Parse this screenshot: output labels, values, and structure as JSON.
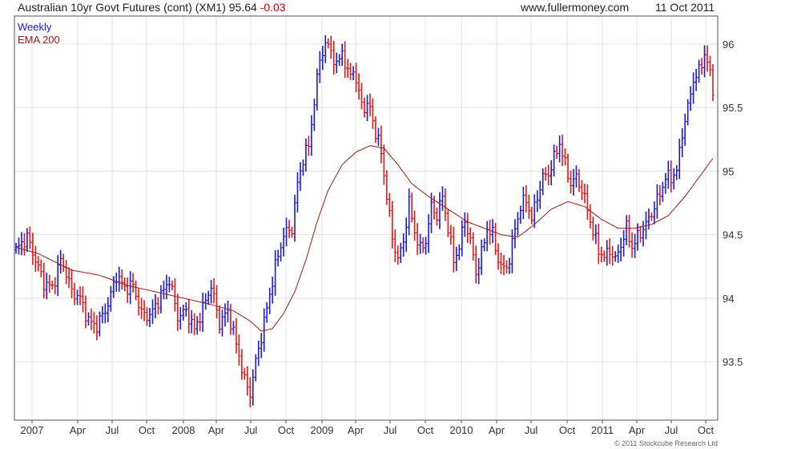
{
  "header": {
    "title_prefix": "Australian 10yr Govt Futures (cont) (XM1) 95.64",
    "change": "-0.03",
    "site": "www.fullermoney.com",
    "date": "11 Oct 2011"
  },
  "footer": {
    "credit": "© 2011 Stockcube Research Ltd"
  },
  "colors": {
    "up": "#1a1ad8",
    "down": "#e01818",
    "ema": "#a01818",
    "grid": "#e3e3e3",
    "frame": "#555555",
    "change": "#cc0000"
  },
  "chart_data": {
    "type": "line",
    "title": "Australian 10yr Govt Futures (cont) (XM1)",
    "frequency": "Weekly",
    "legend": [
      "Weekly",
      "EMA 200"
    ],
    "legend_placement": "top-left",
    "grid": true,
    "x_tick_labels": [
      "2007",
      "Apr",
      "Jul",
      "Oct",
      "2008",
      "Apr",
      "Jul",
      "Oct",
      "2009",
      "Apr",
      "Jul",
      "Oct",
      "2010",
      "Apr",
      "Jul",
      "Oct",
      "2011",
      "Apr",
      "Jul",
      "Oct"
    ],
    "y_tick_labels": [
      "93.5",
      "94",
      "94.5",
      "95",
      "95.5",
      "96"
    ],
    "y_ticks": [
      93.5,
      94,
      94.5,
      95,
      95.5,
      96
    ],
    "ylim": [
      93.04,
      96.22
    ],
    "x_range_weeks": [
      0,
      250
    ],
    "price_close_keypoints": [
      {
        "x": 0,
        "y": 94.38
      },
      {
        "x": 4,
        "y": 94.48
      },
      {
        "x": 7,
        "y": 94.3
      },
      {
        "x": 10,
        "y": 94.12
      },
      {
        "x": 13,
        "y": 94.08
      },
      {
        "x": 16,
        "y": 94.3
      },
      {
        "x": 18,
        "y": 94.2
      },
      {
        "x": 20,
        "y": 94.05
      },
      {
        "x": 23,
        "y": 94.0
      },
      {
        "x": 26,
        "y": 93.82
      },
      {
        "x": 29,
        "y": 93.78
      },
      {
        "x": 33,
        "y": 93.95
      },
      {
        "x": 36,
        "y": 94.18
      },
      {
        "x": 39,
        "y": 94.08
      },
      {
        "x": 42,
        "y": 94.1
      },
      {
        "x": 45,
        "y": 93.88
      },
      {
        "x": 48,
        "y": 93.86
      },
      {
        "x": 52,
        "y": 94.02
      },
      {
        "x": 55,
        "y": 94.15
      },
      {
        "x": 58,
        "y": 93.85
      },
      {
        "x": 61,
        "y": 93.9
      },
      {
        "x": 64,
        "y": 93.75
      },
      {
        "x": 67,
        "y": 93.92
      },
      {
        "x": 70,
        "y": 94.1
      },
      {
        "x": 73,
        "y": 93.8
      },
      {
        "x": 76,
        "y": 93.9
      },
      {
        "x": 80,
        "y": 93.55
      },
      {
        "x": 82,
        "y": 93.35
      },
      {
        "x": 84,
        "y": 93.25
      },
      {
        "x": 86,
        "y": 93.5
      },
      {
        "x": 88,
        "y": 93.7
      },
      {
        "x": 90,
        "y": 93.92
      },
      {
        "x": 93,
        "y": 94.25
      },
      {
        "x": 96,
        "y": 94.5
      },
      {
        "x": 99,
        "y": 94.55
      },
      {
        "x": 101,
        "y": 94.9
      },
      {
        "x": 103,
        "y": 95.1
      },
      {
        "x": 105,
        "y": 95.2
      },
      {
        "x": 107,
        "y": 95.55
      },
      {
        "x": 109,
        "y": 95.88
      },
      {
        "x": 111,
        "y": 96.0
      },
      {
        "x": 113,
        "y": 95.95
      },
      {
        "x": 115,
        "y": 95.82
      },
      {
        "x": 117,
        "y": 95.95
      },
      {
        "x": 119,
        "y": 95.75
      },
      {
        "x": 121,
        "y": 95.8
      },
      {
        "x": 123,
        "y": 95.6
      },
      {
        "x": 125,
        "y": 95.5
      },
      {
        "x": 127,
        "y": 95.5
      },
      {
        "x": 129,
        "y": 95.3
      },
      {
        "x": 131,
        "y": 95.15
      },
      {
        "x": 133,
        "y": 94.8
      },
      {
        "x": 135,
        "y": 94.48
      },
      {
        "x": 137,
        "y": 94.3
      },
      {
        "x": 139,
        "y": 94.45
      },
      {
        "x": 141,
        "y": 94.75
      },
      {
        "x": 143,
        "y": 94.52
      },
      {
        "x": 145,
        "y": 94.38
      },
      {
        "x": 147,
        "y": 94.45
      },
      {
        "x": 149,
        "y": 94.72
      },
      {
        "x": 151,
        "y": 94.65
      },
      {
        "x": 153,
        "y": 94.8
      },
      {
        "x": 155,
        "y": 94.55
      },
      {
        "x": 157,
        "y": 94.3
      },
      {
        "x": 159,
        "y": 94.4
      },
      {
        "x": 161,
        "y": 94.62
      },
      {
        "x": 163,
        "y": 94.45
      },
      {
        "x": 165,
        "y": 94.2
      },
      {
        "x": 167,
        "y": 94.35
      },
      {
        "x": 169,
        "y": 94.55
      },
      {
        "x": 171,
        "y": 94.5
      },
      {
        "x": 173,
        "y": 94.3
      },
      {
        "x": 175,
        "y": 94.22
      },
      {
        "x": 177,
        "y": 94.3
      },
      {
        "x": 179,
        "y": 94.55
      },
      {
        "x": 181,
        "y": 94.72
      },
      {
        "x": 183,
        "y": 94.78
      },
      {
        "x": 185,
        "y": 94.62
      },
      {
        "x": 187,
        "y": 94.8
      },
      {
        "x": 189,
        "y": 94.95
      },
      {
        "x": 191,
        "y": 94.98
      },
      {
        "x": 193,
        "y": 95.1
      },
      {
        "x": 195,
        "y": 95.22
      },
      {
        "x": 197,
        "y": 95.05
      },
      {
        "x": 199,
        "y": 94.9
      },
      {
        "x": 201,
        "y": 94.95
      },
      {
        "x": 203,
        "y": 94.85
      },
      {
        "x": 205,
        "y": 94.7
      },
      {
        "x": 207,
        "y": 94.52
      },
      {
        "x": 209,
        "y": 94.38
      },
      {
        "x": 211,
        "y": 94.32
      },
      {
        "x": 213,
        "y": 94.38
      },
      {
        "x": 215,
        "y": 94.3
      },
      {
        "x": 217,
        "y": 94.42
      },
      {
        "x": 219,
        "y": 94.55
      },
      {
        "x": 221,
        "y": 94.4
      },
      {
        "x": 223,
        "y": 94.48
      },
      {
        "x": 225,
        "y": 94.55
      },
      {
        "x": 227,
        "y": 94.62
      },
      {
        "x": 229,
        "y": 94.72
      },
      {
        "x": 231,
        "y": 94.82
      },
      {
        "x": 233,
        "y": 94.95
      },
      {
        "x": 235,
        "y": 94.95
      },
      {
        "x": 237,
        "y": 95.0
      },
      {
        "x": 239,
        "y": 95.3
      },
      {
        "x": 241,
        "y": 95.5
      },
      {
        "x": 243,
        "y": 95.72
      },
      {
        "x": 245,
        "y": 95.78
      },
      {
        "x": 247,
        "y": 95.92
      },
      {
        "x": 248,
        "y": 95.86
      },
      {
        "x": 250,
        "y": 95.64
      }
    ],
    "ema_keypoints": [
      {
        "x": 0,
        "y": 94.4
      },
      {
        "x": 8,
        "y": 94.35
      },
      {
        "x": 20,
        "y": 94.22
      },
      {
        "x": 30,
        "y": 94.18
      },
      {
        "x": 40,
        "y": 94.1
      },
      {
        "x": 50,
        "y": 94.05
      },
      {
        "x": 60,
        "y": 94.0
      },
      {
        "x": 70,
        "y": 93.95
      },
      {
        "x": 78,
        "y": 93.9
      },
      {
        "x": 84,
        "y": 93.82
      },
      {
        "x": 88,
        "y": 93.74
      },
      {
        "x": 92,
        "y": 93.76
      },
      {
        "x": 96,
        "y": 93.88
      },
      {
        "x": 100,
        "y": 94.05
      },
      {
        "x": 104,
        "y": 94.3
      },
      {
        "x": 108,
        "y": 94.6
      },
      {
        "x": 112,
        "y": 94.85
      },
      {
        "x": 117,
        "y": 95.05
      },
      {
        "x": 122,
        "y": 95.15
      },
      {
        "x": 127,
        "y": 95.2
      },
      {
        "x": 132,
        "y": 95.18
      },
      {
        "x": 137,
        "y": 95.05
      },
      {
        "x": 142,
        "y": 94.9
      },
      {
        "x": 148,
        "y": 94.8
      },
      {
        "x": 155,
        "y": 94.7
      },
      {
        "x": 162,
        "y": 94.6
      },
      {
        "x": 168,
        "y": 94.55
      },
      {
        "x": 174,
        "y": 94.5
      },
      {
        "x": 180,
        "y": 94.48
      },
      {
        "x": 186,
        "y": 94.58
      },
      {
        "x": 192,
        "y": 94.7
      },
      {
        "x": 198,
        "y": 94.76
      },
      {
        "x": 204,
        "y": 94.72
      },
      {
        "x": 210,
        "y": 94.62
      },
      {
        "x": 216,
        "y": 94.55
      },
      {
        "x": 222,
        "y": 94.55
      },
      {
        "x": 228,
        "y": 94.58
      },
      {
        "x": 234,
        "y": 94.65
      },
      {
        "x": 240,
        "y": 94.8
      },
      {
        "x": 245,
        "y": 94.95
      },
      {
        "x": 250,
        "y": 95.1
      }
    ]
  }
}
